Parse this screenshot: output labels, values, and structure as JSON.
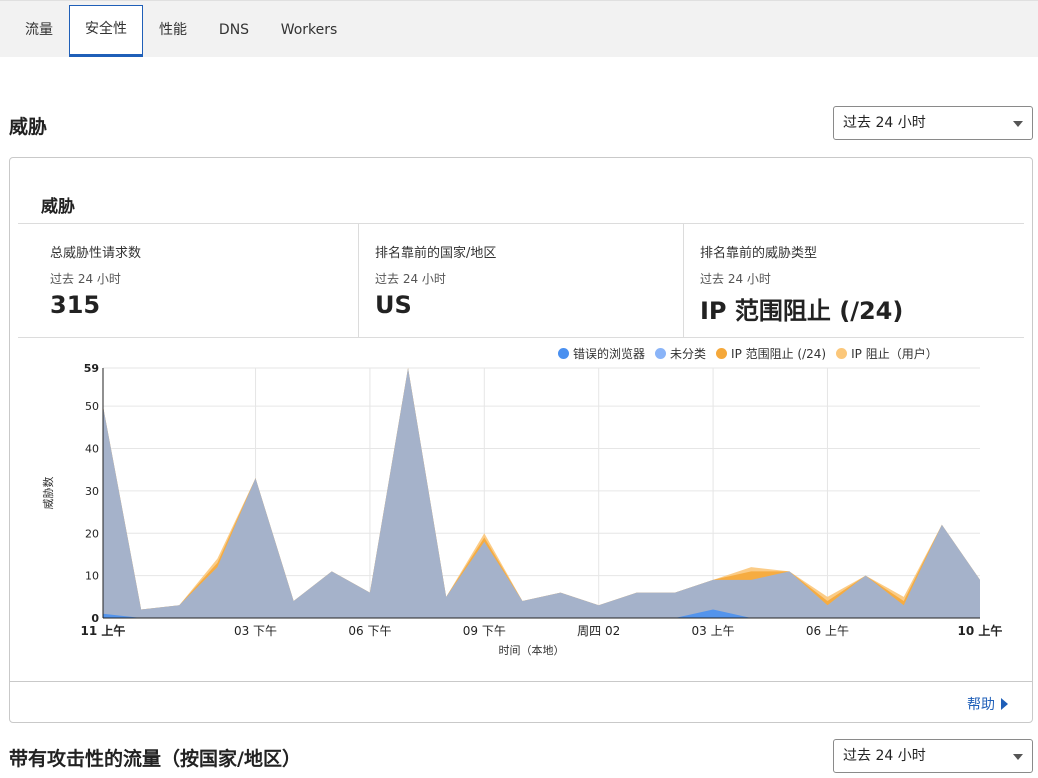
{
  "tabs": [
    {
      "label": "流量",
      "active": false
    },
    {
      "label": "安全性",
      "active": true
    },
    {
      "label": "性能",
      "active": false
    },
    {
      "label": "DNS",
      "active": false
    },
    {
      "label": "Workers",
      "active": false
    }
  ],
  "section1": {
    "title": "威胁",
    "range_select": "过去 24 小时"
  },
  "card": {
    "title": "威胁",
    "stats": [
      {
        "label": "总威胁性请求数",
        "sub": "过去 24 小时",
        "value": "315"
      },
      {
        "label": "排名靠前的国家/地区",
        "sub": "过去 24 小时",
        "value": "US"
      },
      {
        "label": "排名靠前的威胁类型",
        "sub": "过去 24 小时",
        "value": "IP 范围阻止 (/24)"
      }
    ],
    "help_link": "帮助"
  },
  "section2": {
    "title": "带有攻击性的流量（按国家/地区）",
    "range_select": "过去 24 小时"
  },
  "colors": {
    "accent": "#1f5fb8",
    "bad_browser": "#4a90f0",
    "unclassified": "#8ab4f8",
    "ip_range_block": "#f5a83a",
    "ip_block_user": "#fbc77a"
  },
  "chart_data": {
    "type": "area",
    "stacked": true,
    "ylabel": "威胁数",
    "xlabel": "时间（本地）",
    "ylim": [
      0,
      59
    ],
    "y_ticks": [
      0,
      10,
      20,
      30,
      40,
      50,
      59
    ],
    "x_tick_labels": [
      {
        "index": 0,
        "label": "11 上午",
        "bold": true
      },
      {
        "index": 4,
        "label": "03 下午",
        "bold": false
      },
      {
        "index": 7,
        "label": "06 下午",
        "bold": false
      },
      {
        "index": 10,
        "label": "09 下午",
        "bold": false
      },
      {
        "index": 13,
        "label": "周四 02",
        "bold": false
      },
      {
        "index": 16,
        "label": "03 上午",
        "bold": false
      },
      {
        "index": 19,
        "label": "06 上午",
        "bold": false
      },
      {
        "index": 23,
        "label": "10 上午",
        "bold": true
      }
    ],
    "grid": true,
    "legend_position": "top-right",
    "series": [
      {
        "name": "错误的浏览器",
        "color_key": "bad_browser",
        "values": [
          1,
          0,
          0,
          0,
          0,
          0,
          0,
          0,
          0,
          0,
          0,
          0,
          0,
          0,
          0,
          0,
          2,
          0,
          0,
          0,
          0,
          0,
          0,
          0
        ]
      },
      {
        "name": "未分类",
        "color_key": "unclassified",
        "values": [
          49,
          2,
          3,
          12,
          33,
          4,
          11,
          6,
          59,
          5,
          18,
          4,
          6,
          3,
          6,
          6,
          7,
          9,
          11,
          3,
          10,
          3,
          22,
          9
        ]
      },
      {
        "name": "IP 范围阻止 (/24)",
        "color_key": "ip_range_block",
        "values": [
          0,
          0,
          0,
          1,
          0,
          0,
          0,
          0,
          0,
          0,
          1,
          0,
          0,
          0,
          0,
          0,
          0,
          2,
          0,
          1,
          0,
          1,
          0,
          0
        ]
      },
      {
        "name": "IP 阻止（用户）",
        "color_key": "ip_block_user",
        "values": [
          0,
          0,
          0,
          1,
          0,
          0,
          0,
          0,
          0,
          0,
          1,
          0,
          0,
          0,
          0,
          0,
          0,
          1,
          0,
          1,
          0,
          1,
          0,
          0
        ]
      }
    ]
  }
}
